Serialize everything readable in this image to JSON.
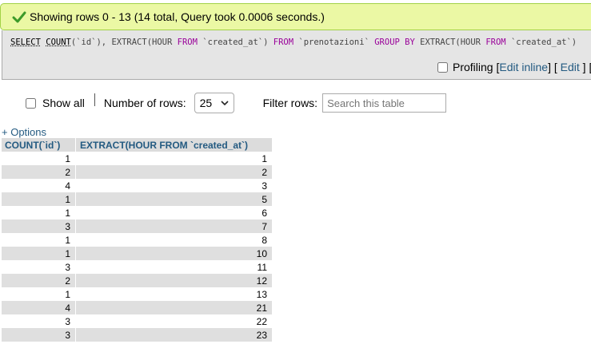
{
  "status": {
    "message": "Showing rows 0 - 13 (14 total, Query took 0.0006 seconds.)",
    "color": "#ebf8a4"
  },
  "sql": {
    "kw_select": "SELECT",
    "fn_count": "COUNT",
    "p1": "(`id`), ",
    "fn_extract": "EXTRACT",
    "p2": "(HOUR ",
    "kw_from1": "FROM",
    "p3": " `created_at`) ",
    "kw_from2": "FROM",
    "p4": " `prenotazioni` ",
    "kw_group": "GROUP BY",
    "p5": " EXTRACT(HOUR ",
    "kw_from3": "FROM",
    "p6": " `created_at`)"
  },
  "profiling": {
    "label": "Profiling",
    "edit_inline": "Edit inline",
    "edit": "Edit",
    "open1": "[",
    "close1": "]",
    "tail": "[ E"
  },
  "controls": {
    "show_all": "Show all",
    "rows_label": "Number of rows:",
    "rows_value": "25",
    "filter_label": "Filter rows:",
    "filter_placeholder": "Search this table"
  },
  "options_link": "+ Options",
  "table": {
    "headers": [
      "COUNT(`id`)",
      "EXTRACT(HOUR FROM `created_at`)"
    ],
    "rows": [
      [
        "1",
        "1"
      ],
      [
        "2",
        "2"
      ],
      [
        "4",
        "3"
      ],
      [
        "1",
        "5"
      ],
      [
        "1",
        "6"
      ],
      [
        "3",
        "7"
      ],
      [
        "1",
        "8"
      ],
      [
        "1",
        "10"
      ],
      [
        "3",
        "11"
      ],
      [
        "2",
        "12"
      ],
      [
        "1",
        "13"
      ],
      [
        "4",
        "21"
      ],
      [
        "3",
        "22"
      ],
      [
        "3",
        "23"
      ]
    ]
  },
  "colors": {
    "link": "#235a81",
    "keyword": "#990099",
    "header_bg": "#dcdcdc",
    "row_alt": "#dfdfdf"
  }
}
